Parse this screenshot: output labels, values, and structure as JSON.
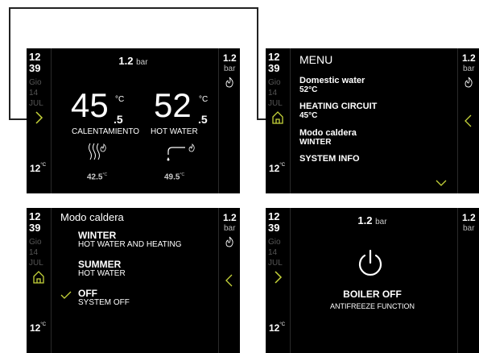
{
  "colors": {
    "background": "#000000",
    "accent": "#c6d43a",
    "text": "#ffffff",
    "muted": "#555555"
  },
  "sidebar": {
    "hour": "12",
    "minute": "39",
    "day_name": "Gio",
    "day": "14",
    "month": "JUL",
    "ext_temp": "12",
    "ext_unit": "°C"
  },
  "pressure": {
    "value": "1.2",
    "unit": "bar"
  },
  "home": {
    "heating": {
      "value": "45",
      "decimal": ".5",
      "unit": "°C",
      "label": "CALENTAMIENTO",
      "setpoint": "42.5",
      "setpoint_unit": "°C"
    },
    "hot_water": {
      "value": "52",
      "decimal": ".5",
      "unit": "°C",
      "label": "HOT WATER",
      "setpoint": "49.5",
      "setpoint_unit": "°C"
    }
  },
  "menu": {
    "title": "MENU",
    "items": [
      {
        "label": "Domestic water",
        "value": "52°C"
      },
      {
        "label": "HEATING CIRCUIT",
        "value": "45°C"
      },
      {
        "label": "Modo caldera",
        "value": "WINTER"
      },
      {
        "label": "SYSTEM INFO",
        "value": ""
      }
    ]
  },
  "mode_screen": {
    "title": "Modo caldera",
    "modes": [
      {
        "name": "WINTER",
        "desc": "HOT WATER AND HEATING",
        "selected": false
      },
      {
        "name": "SUMMER",
        "desc": "HOT WATER",
        "selected": false
      },
      {
        "name": "OFF",
        "desc": "SYSTEM OFF",
        "selected": true
      }
    ]
  },
  "off_screen": {
    "status": "BOILER OFF",
    "function": "ANTIFREEZE FUNCTION"
  },
  "icons": [
    "chevron-right-icon",
    "home-icon",
    "chevron-left-icon",
    "flame-icon",
    "radiator-icon",
    "faucet-icon",
    "power-icon",
    "chevron-down-icon",
    "check-icon"
  ]
}
